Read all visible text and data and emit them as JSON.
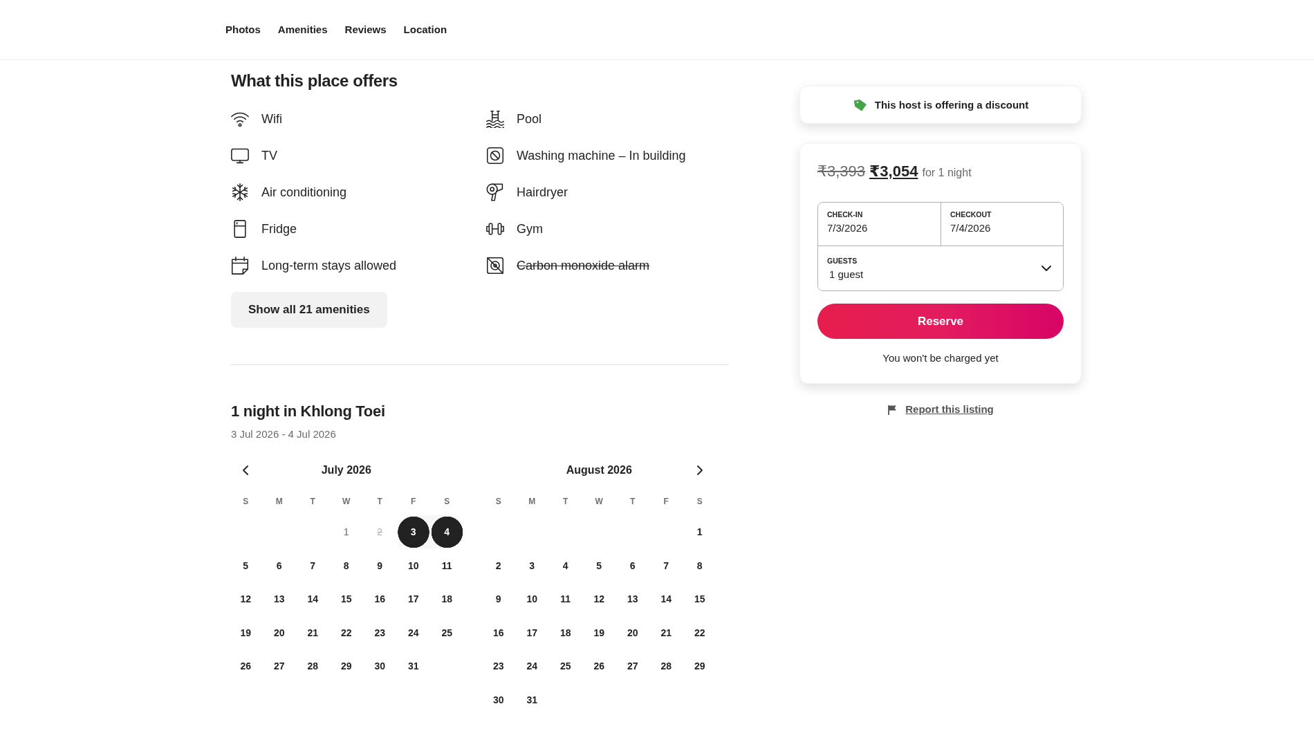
{
  "nav": {
    "links": [
      "Photos",
      "Amenities",
      "Reviews",
      "Location"
    ]
  },
  "amenities": {
    "title": "What this place offers",
    "items": [
      {
        "label": "Wifi",
        "kind": "wifi",
        "available": true
      },
      {
        "label": "Pool",
        "kind": "pool",
        "available": true
      },
      {
        "label": "TV",
        "kind": "tv",
        "available": true
      },
      {
        "label": "Washing machine – In building",
        "kind": "washer",
        "available": true
      },
      {
        "label": "Air conditioning",
        "kind": "ac",
        "available": true
      },
      {
        "label": "Hairdryer",
        "kind": "hairdryer",
        "available": true
      },
      {
        "label": "Fridge",
        "kind": "fridge",
        "available": true
      },
      {
        "label": "Gym",
        "kind": "gym",
        "available": true
      },
      {
        "label": "Long-term stays allowed",
        "kind": "long_stay",
        "available": true
      },
      {
        "label": "Carbon monoxide alarm",
        "kind": "co_alarm",
        "available": false
      }
    ],
    "button": "Show all 21 amenities"
  },
  "stay": {
    "title": "1 night in Khlong Toei",
    "dates": "3 Jul 2026 - 4 Jul 2026"
  },
  "calendar": {
    "months": [
      {
        "title": "July 2026",
        "weekdays": [
          "S",
          "M",
          "T",
          "W",
          "T",
          "F",
          "S"
        ],
        "weeks": [
          {
            "align_end": true,
            "days": [
              {
                "day": "1",
                "selected": false,
                "available": false,
                "blocked": false
              },
              {
                "day": "2",
                "selected": false,
                "available": false,
                "blocked": true
              },
              {
                "day": "3",
                "selected": true,
                "available": true,
                "blocked": false
              },
              {
                "day": "4",
                "selected": true,
                "available": true,
                "blocked": false
              }
            ]
          },
          {
            "align_end": false,
            "days": [
              {
                "day": "5",
                "selected": false,
                "available": true,
                "blocked": false
              },
              {
                "day": "6",
                "selected": false,
                "available": true,
                "blocked": false
              },
              {
                "day": "7",
                "selected": false,
                "available": true,
                "blocked": false
              },
              {
                "day": "8",
                "selected": false,
                "available": true,
                "blocked": false
              },
              {
                "day": "9",
                "selected": false,
                "available": true,
                "blocked": false
              },
              {
                "day": "10",
                "selected": false,
                "available": true,
                "blocked": false
              },
              {
                "day": "11",
                "selected": false,
                "available": true,
                "blocked": false
              }
            ]
          },
          {
            "align_end": false,
            "days": [
              {
                "day": "12",
                "selected": false,
                "available": true,
                "blocked": false
              },
              {
                "day": "13",
                "selected": false,
                "available": true,
                "blocked": false
              },
              {
                "day": "14",
                "selected": false,
                "available": true,
                "blocked": false
              },
              {
                "day": "15",
                "selected": false,
                "available": true,
                "blocked": false
              },
              {
                "day": "16",
                "selected": false,
                "available": true,
                "blocked": false
              },
              {
                "day": "17",
                "selected": false,
                "available": true,
                "blocked": false
              },
              {
                "day": "18",
                "selected": false,
                "available": true,
                "blocked": false
              }
            ]
          },
          {
            "align_end": false,
            "days": [
              {
                "day": "19",
                "selected": false,
                "available": true,
                "blocked": false
              },
              {
                "day": "20",
                "selected": false,
                "available": true,
                "blocked": false
              },
              {
                "day": "21",
                "selected": false,
                "available": true,
                "blocked": false
              },
              {
                "day": "22",
                "selected": false,
                "available": true,
                "blocked": false
              },
              {
                "day": "23",
                "selected": false,
                "available": true,
                "blocked": false
              },
              {
                "day": "24",
                "selected": false,
                "available": true,
                "blocked": false
              },
              {
                "day": "25",
                "selected": false,
                "available": true,
                "blocked": false
              }
            ]
          },
          {
            "align_end": false,
            "days": [
              {
                "day": "26",
                "selected": false,
                "available": true,
                "blocked": false
              },
              {
                "day": "27",
                "selected": false,
                "available": true,
                "blocked": false
              },
              {
                "day": "28",
                "selected": false,
                "available": true,
                "blocked": false
              },
              {
                "day": "29",
                "selected": false,
                "available": true,
                "blocked": false
              },
              {
                "day": "30",
                "selected": false,
                "available": true,
                "blocked": false
              },
              {
                "day": "31",
                "selected": false,
                "available": true,
                "blocked": false
              }
            ]
          }
        ]
      },
      {
        "title": "August 2026",
        "weekdays": [
          "S",
          "M",
          "T",
          "W",
          "T",
          "F",
          "S"
        ],
        "weeks": [
          {
            "align_end": true,
            "days": [
              {
                "day": "1",
                "selected": false,
                "available": true,
                "blocked": false
              }
            ]
          },
          {
            "align_end": false,
            "days": [
              {
                "day": "2",
                "selected": false,
                "available": true,
                "blocked": false
              },
              {
                "day": "3",
                "selected": false,
                "available": true,
                "blocked": false
              },
              {
                "day": "4",
                "selected": false,
                "available": true,
                "blocked": false
              },
              {
                "day": "5",
                "selected": false,
                "available": true,
                "blocked": false
              },
              {
                "day": "6",
                "selected": false,
                "available": true,
                "blocked": false
              },
              {
                "day": "7",
                "selected": false,
                "available": true,
                "blocked": false
              },
              {
                "day": "8",
                "selected": false,
                "available": true,
                "blocked": false
              }
            ]
          },
          {
            "align_end": false,
            "days": [
              {
                "day": "9",
                "selected": false,
                "available": true,
                "blocked": false
              },
              {
                "day": "10",
                "selected": false,
                "available": true,
                "blocked": false
              },
              {
                "day": "11",
                "selected": false,
                "available": true,
                "blocked": false
              },
              {
                "day": "12",
                "selected": false,
                "available": true,
                "blocked": false
              },
              {
                "day": "13",
                "selected": false,
                "available": true,
                "blocked": false
              },
              {
                "day": "14",
                "selected": false,
                "available": true,
                "blocked": false
              },
              {
                "day": "15",
                "selected": false,
                "available": true,
                "blocked": false
              }
            ]
          },
          {
            "align_end": false,
            "days": [
              {
                "day": "16",
                "selected": false,
                "available": true,
                "blocked": false
              },
              {
                "day": "17",
                "selected": false,
                "available": true,
                "blocked": false
              },
              {
                "day": "18",
                "selected": false,
                "available": true,
                "blocked": false
              },
              {
                "day": "19",
                "selected": false,
                "available": true,
                "blocked": false
              },
              {
                "day": "20",
                "selected": false,
                "available": true,
                "blocked": false
              },
              {
                "day": "21",
                "selected": false,
                "available": true,
                "blocked": false
              },
              {
                "day": "22",
                "selected": false,
                "available": true,
                "blocked": false
              }
            ]
          },
          {
            "align_end": false,
            "days": [
              {
                "day": "23",
                "selected": false,
                "available": true,
                "blocked": false
              },
              {
                "day": "24",
                "selected": false,
                "available": true,
                "blocked": false
              },
              {
                "day": "25",
                "selected": false,
                "available": true,
                "blocked": false
              },
              {
                "day": "26",
                "selected": false,
                "available": true,
                "blocked": false
              },
              {
                "day": "27",
                "selected": false,
                "available": true,
                "blocked": false
              },
              {
                "day": "28",
                "selected": false,
                "available": true,
                "blocked": false
              },
              {
                "day": "29",
                "selected": false,
                "available": true,
                "blocked": false
              }
            ]
          },
          {
            "align_end": false,
            "days": [
              {
                "day": "30",
                "selected": false,
                "available": true,
                "blocked": false
              },
              {
                "day": "31",
                "selected": false,
                "available": true,
                "blocked": false
              }
            ]
          }
        ]
      }
    ]
  },
  "discount": {
    "text": "This host is offering a discount"
  },
  "booking": {
    "original_price": "₹3,393",
    "price": "₹3,054",
    "price_unit": "for 1 night",
    "check_in": {
      "label": "CHECK-IN",
      "value": "7/3/2026"
    },
    "checkout": {
      "label": "CHECKOUT",
      "value": "7/4/2026"
    },
    "guests": {
      "label": "GUESTS",
      "value": "1 guest"
    },
    "reserve": "Reserve",
    "note": "You won't be charged yet"
  },
  "report": {
    "link": "Report this listing"
  }
}
